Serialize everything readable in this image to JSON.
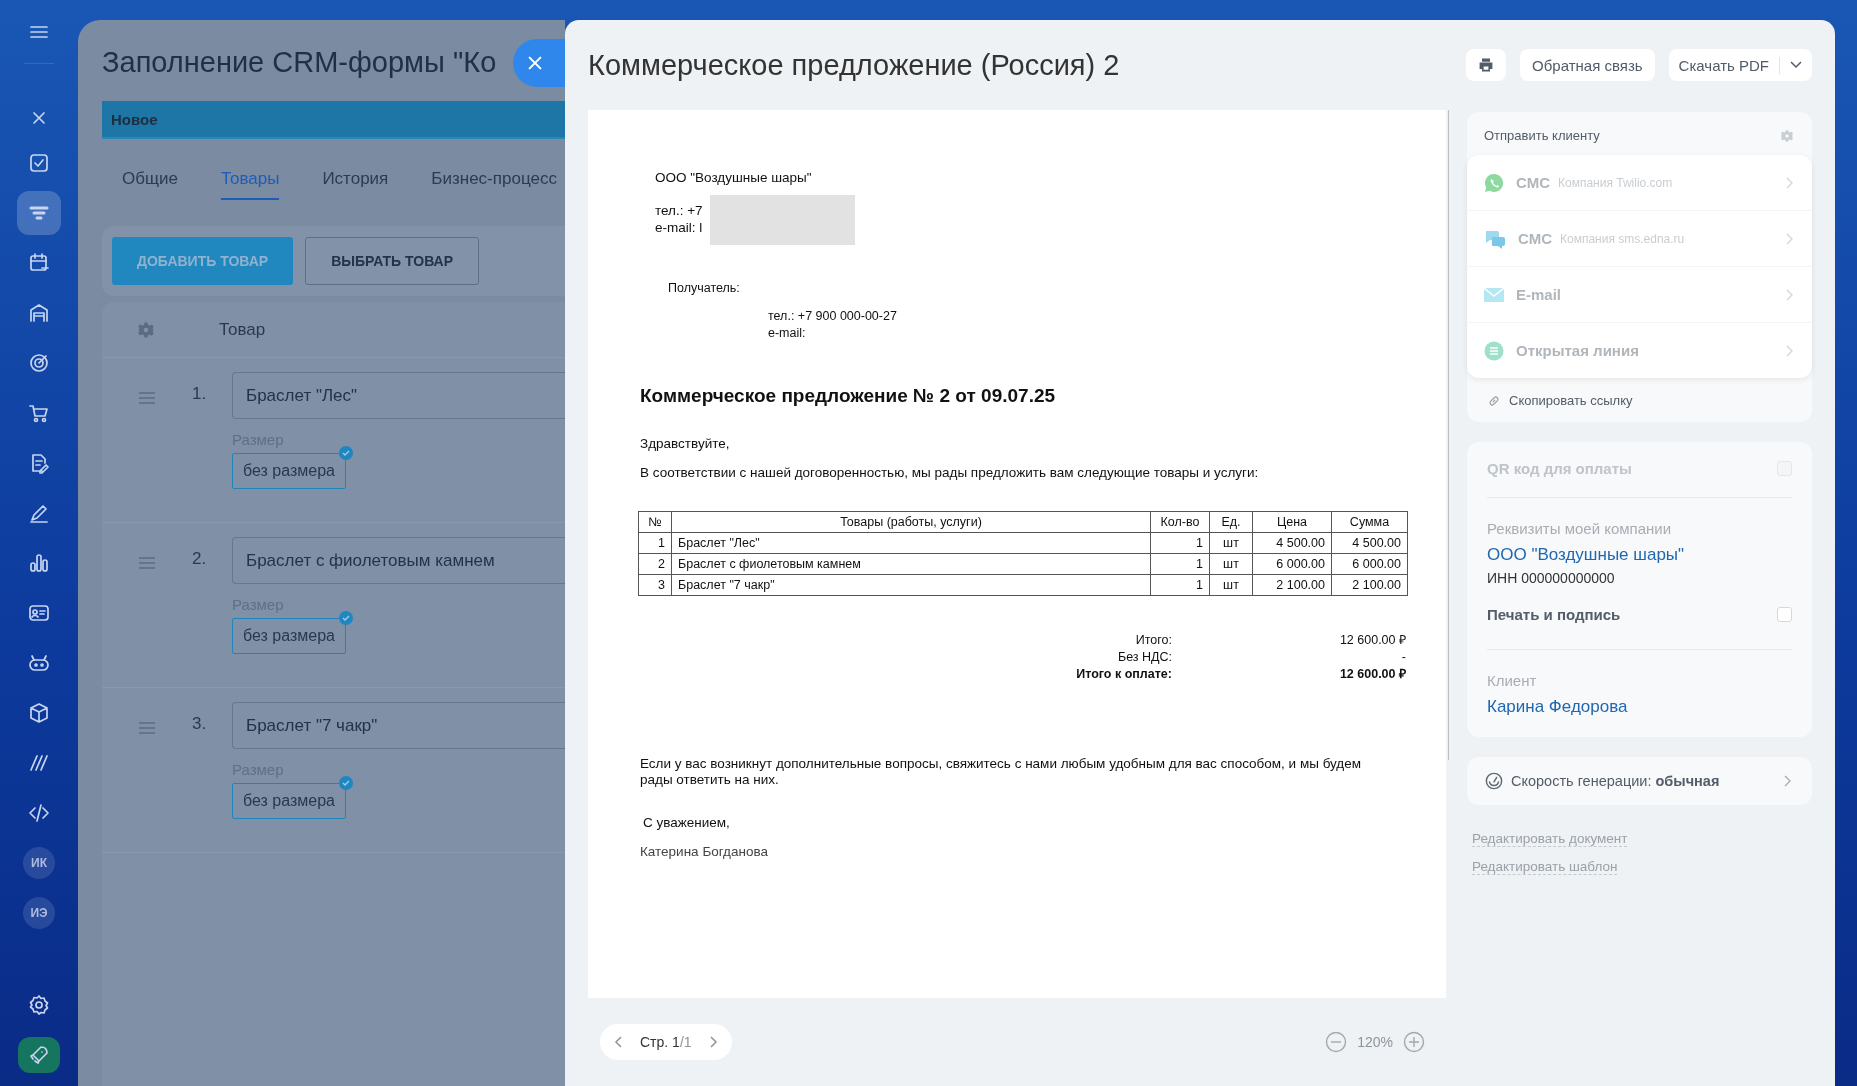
{
  "sidebar": {
    "items": [
      {
        "kind": "icon",
        "selected": false
      },
      {
        "kind": "icon",
        "selected": false
      },
      {
        "kind": "icon",
        "selected": false
      },
      {
        "kind": "icon",
        "selected": true
      },
      {
        "kind": "icon",
        "selected": false
      },
      {
        "kind": "icon",
        "selected": false
      },
      {
        "kind": "icon",
        "selected": false
      },
      {
        "kind": "icon",
        "selected": false
      },
      {
        "kind": "icon",
        "selected": false
      },
      {
        "kind": "icon",
        "selected": false
      },
      {
        "kind": "icon",
        "selected": false
      },
      {
        "kind": "icon",
        "selected": false
      },
      {
        "kind": "icon",
        "selected": false
      },
      {
        "kind": "icon",
        "selected": false
      },
      {
        "kind": "icon",
        "selected": false
      },
      {
        "kind": "icon",
        "selected": false
      },
      {
        "kind": "avatar",
        "initials": "ИК",
        "selected": false
      },
      {
        "kind": "avatar",
        "initials": "ИЭ",
        "selected": false
      },
      {
        "kind": "icon",
        "selected": false
      },
      {
        "kind": "launch",
        "selected": false
      }
    ]
  },
  "background_form": {
    "title": "Заполнение CRM-формы \"Ко",
    "stage": "Новое",
    "tabs": [
      {
        "label": "Общие",
        "selected": false
      },
      {
        "label": "Товары",
        "selected": true
      },
      {
        "label": "История",
        "selected": false
      },
      {
        "label": "Бизнес-процесс",
        "selected": false
      }
    ],
    "buttons": [
      {
        "label": "ДОБАВИТЬ ТОВАР",
        "kind": "primary"
      },
      {
        "label": "ВЫБРАТЬ ТОВАР",
        "kind": "outline"
      }
    ],
    "product_column": "Товар",
    "products": [
      {
        "number": "1.",
        "name": "Браслет \"Лес\"",
        "size_label": "Размер",
        "size": "без размера",
        "confirmed": true
      },
      {
        "number": "2.",
        "name": "Браслет с фиолетовым камнем",
        "size_label": "Размер",
        "size": "без размера",
        "confirmed": true
      },
      {
        "number": "3.",
        "name": "Браслет \"7 чакр\"",
        "size_label": "Размер",
        "size": "без размера",
        "confirmed": true
      }
    ]
  },
  "document_viewer": {
    "title": "Коммерческое предложение (Россия) 2",
    "actions": [
      {
        "kind": "print"
      },
      {
        "kind": "text",
        "label": "Обратная связь"
      },
      {
        "kind": "split",
        "label": "Скачать PDF"
      }
    ],
    "page": {
      "sender": "ООО \"Воздушные шары\"",
      "sender_phone": "тел.: +7",
      "sender_email": "e-mail: l",
      "recipient_label": "Получатель:",
      "recipient_phone": "тел.: +7 900 000-00-27",
      "recipient_email": "e-mail:",
      "heading": "Коммерческое предложение № 2 от 09.07.25",
      "greeting": "Здравствуйте,",
      "intro": "В соответствии с нашей договоренностью, мы рады предложить вам следующие товары и услуги:",
      "table": {
        "columns": [
          "№",
          "Товары (работы, услуги)",
          "Кол-во",
          "Ед.",
          "Цена",
          "Сумма"
        ],
        "rows": [
          [
            "1",
            "Браслет \"Лес\"",
            "1",
            "шт",
            "4 500.00",
            "4 500.00"
          ],
          [
            "2",
            "Браслет с фиолетовым камнем",
            "1",
            "шт",
            "6 000.00",
            "6 000.00"
          ],
          [
            "3",
            "Браслет \"7 чакр\"",
            "1",
            "шт",
            "2 100.00",
            "2 100.00"
          ]
        ]
      },
      "totals": [
        {
          "label": "Итого:",
          "value": "12 600.00 ₽",
          "bold": false
        },
        {
          "label": "Без НДС:",
          "value": "-",
          "bold": false
        },
        {
          "label": "Итого к оплате:",
          "value": "12 600.00 ₽",
          "bold": true
        }
      ],
      "closing_note": "Если у вас возникнут дополнительные вопросы, свяжитесь с нами любым удобным для вас способом, и мы будем рады ответить на них.",
      "sign_off": "С уважением,",
      "signer": "Катерина Богданова"
    },
    "pager": {
      "page": "Стр. 1",
      "total": "/1"
    },
    "zoom": "120%"
  },
  "send_card": {
    "title": "Отправить клиенту",
    "channels": [
      {
        "kind": "whatsapp",
        "name": "СМС",
        "provider": "Компания Twilio.com"
      },
      {
        "kind": "chat",
        "name": "СМС",
        "provider": "Компания sms.edna.ru"
      },
      {
        "kind": "email",
        "name": "E-mail"
      },
      {
        "kind": "openline",
        "name": "Открытая линия"
      }
    ],
    "copy_link": "Скопировать ссылку"
  },
  "settings_card": {
    "qr": {
      "label": "QR код для оплаты",
      "checked": false,
      "disabled": true
    },
    "company_label": "Реквизиты моей компании",
    "company": "ООО \"Воздушные шары\"",
    "inn": "ИНН 000000000000",
    "stamp": {
      "label": "Печать и подпись",
      "checked": false,
      "disabled": false
    },
    "client_label": "Клиент",
    "client": "Карина Федорова"
  },
  "speed": "Скорость генерации: **обычная**",
  "links": [
    "Редактировать документ",
    "Редактировать шаблон"
  ]
}
